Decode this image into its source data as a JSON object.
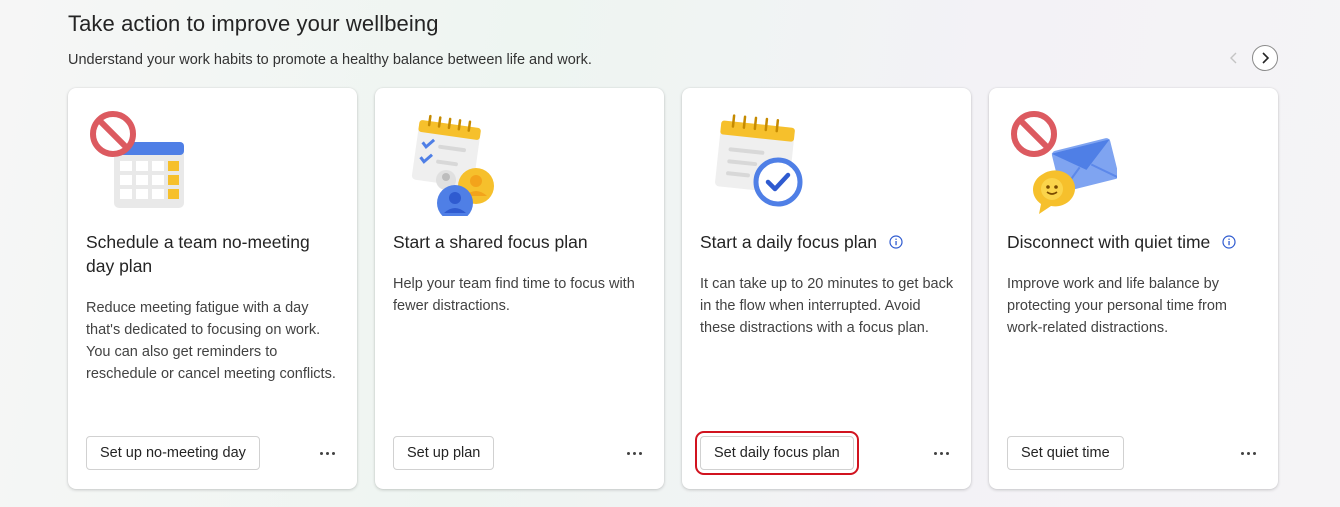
{
  "header": {
    "title": "Take action to improve your wellbeing",
    "subtitle": "Understand your work habits to promote a healthy balance between life and work."
  },
  "cards": [
    {
      "title": "Schedule a team no-meeting day plan",
      "description": "Reduce meeting fatigue with a day that's dedicated to focusing on work. You can also get reminders to reschedule or cancel meeting conflicts.",
      "button_label": "Set up no-meeting day",
      "icon": "no-meeting-calendar-illustration"
    },
    {
      "title": "Start a shared focus plan",
      "description": "Help your team find time to focus with fewer distractions.",
      "button_label": "Set up plan",
      "icon": "shared-focus-illustration"
    },
    {
      "title": "Start a daily focus plan",
      "description": "It can take up to 20 minutes to get back in the flow when interrupted. Avoid these distractions with a focus plan.",
      "button_label": "Set daily focus plan",
      "icon": "daily-focus-illustration",
      "has_info": true,
      "highlighted": true
    },
    {
      "title": "Disconnect with quiet time",
      "description": "Improve work and life balance by protecting your personal time from work-related distractions.",
      "button_label": "Set quiet time",
      "icon": "quiet-time-illustration",
      "has_info": true
    }
  ],
  "colors": {
    "accent_red": "#d1131f",
    "info_blue": "#2f5bd0",
    "calendar_yellow": "#f6c02c",
    "no_sign_red": "#dc5a60"
  }
}
